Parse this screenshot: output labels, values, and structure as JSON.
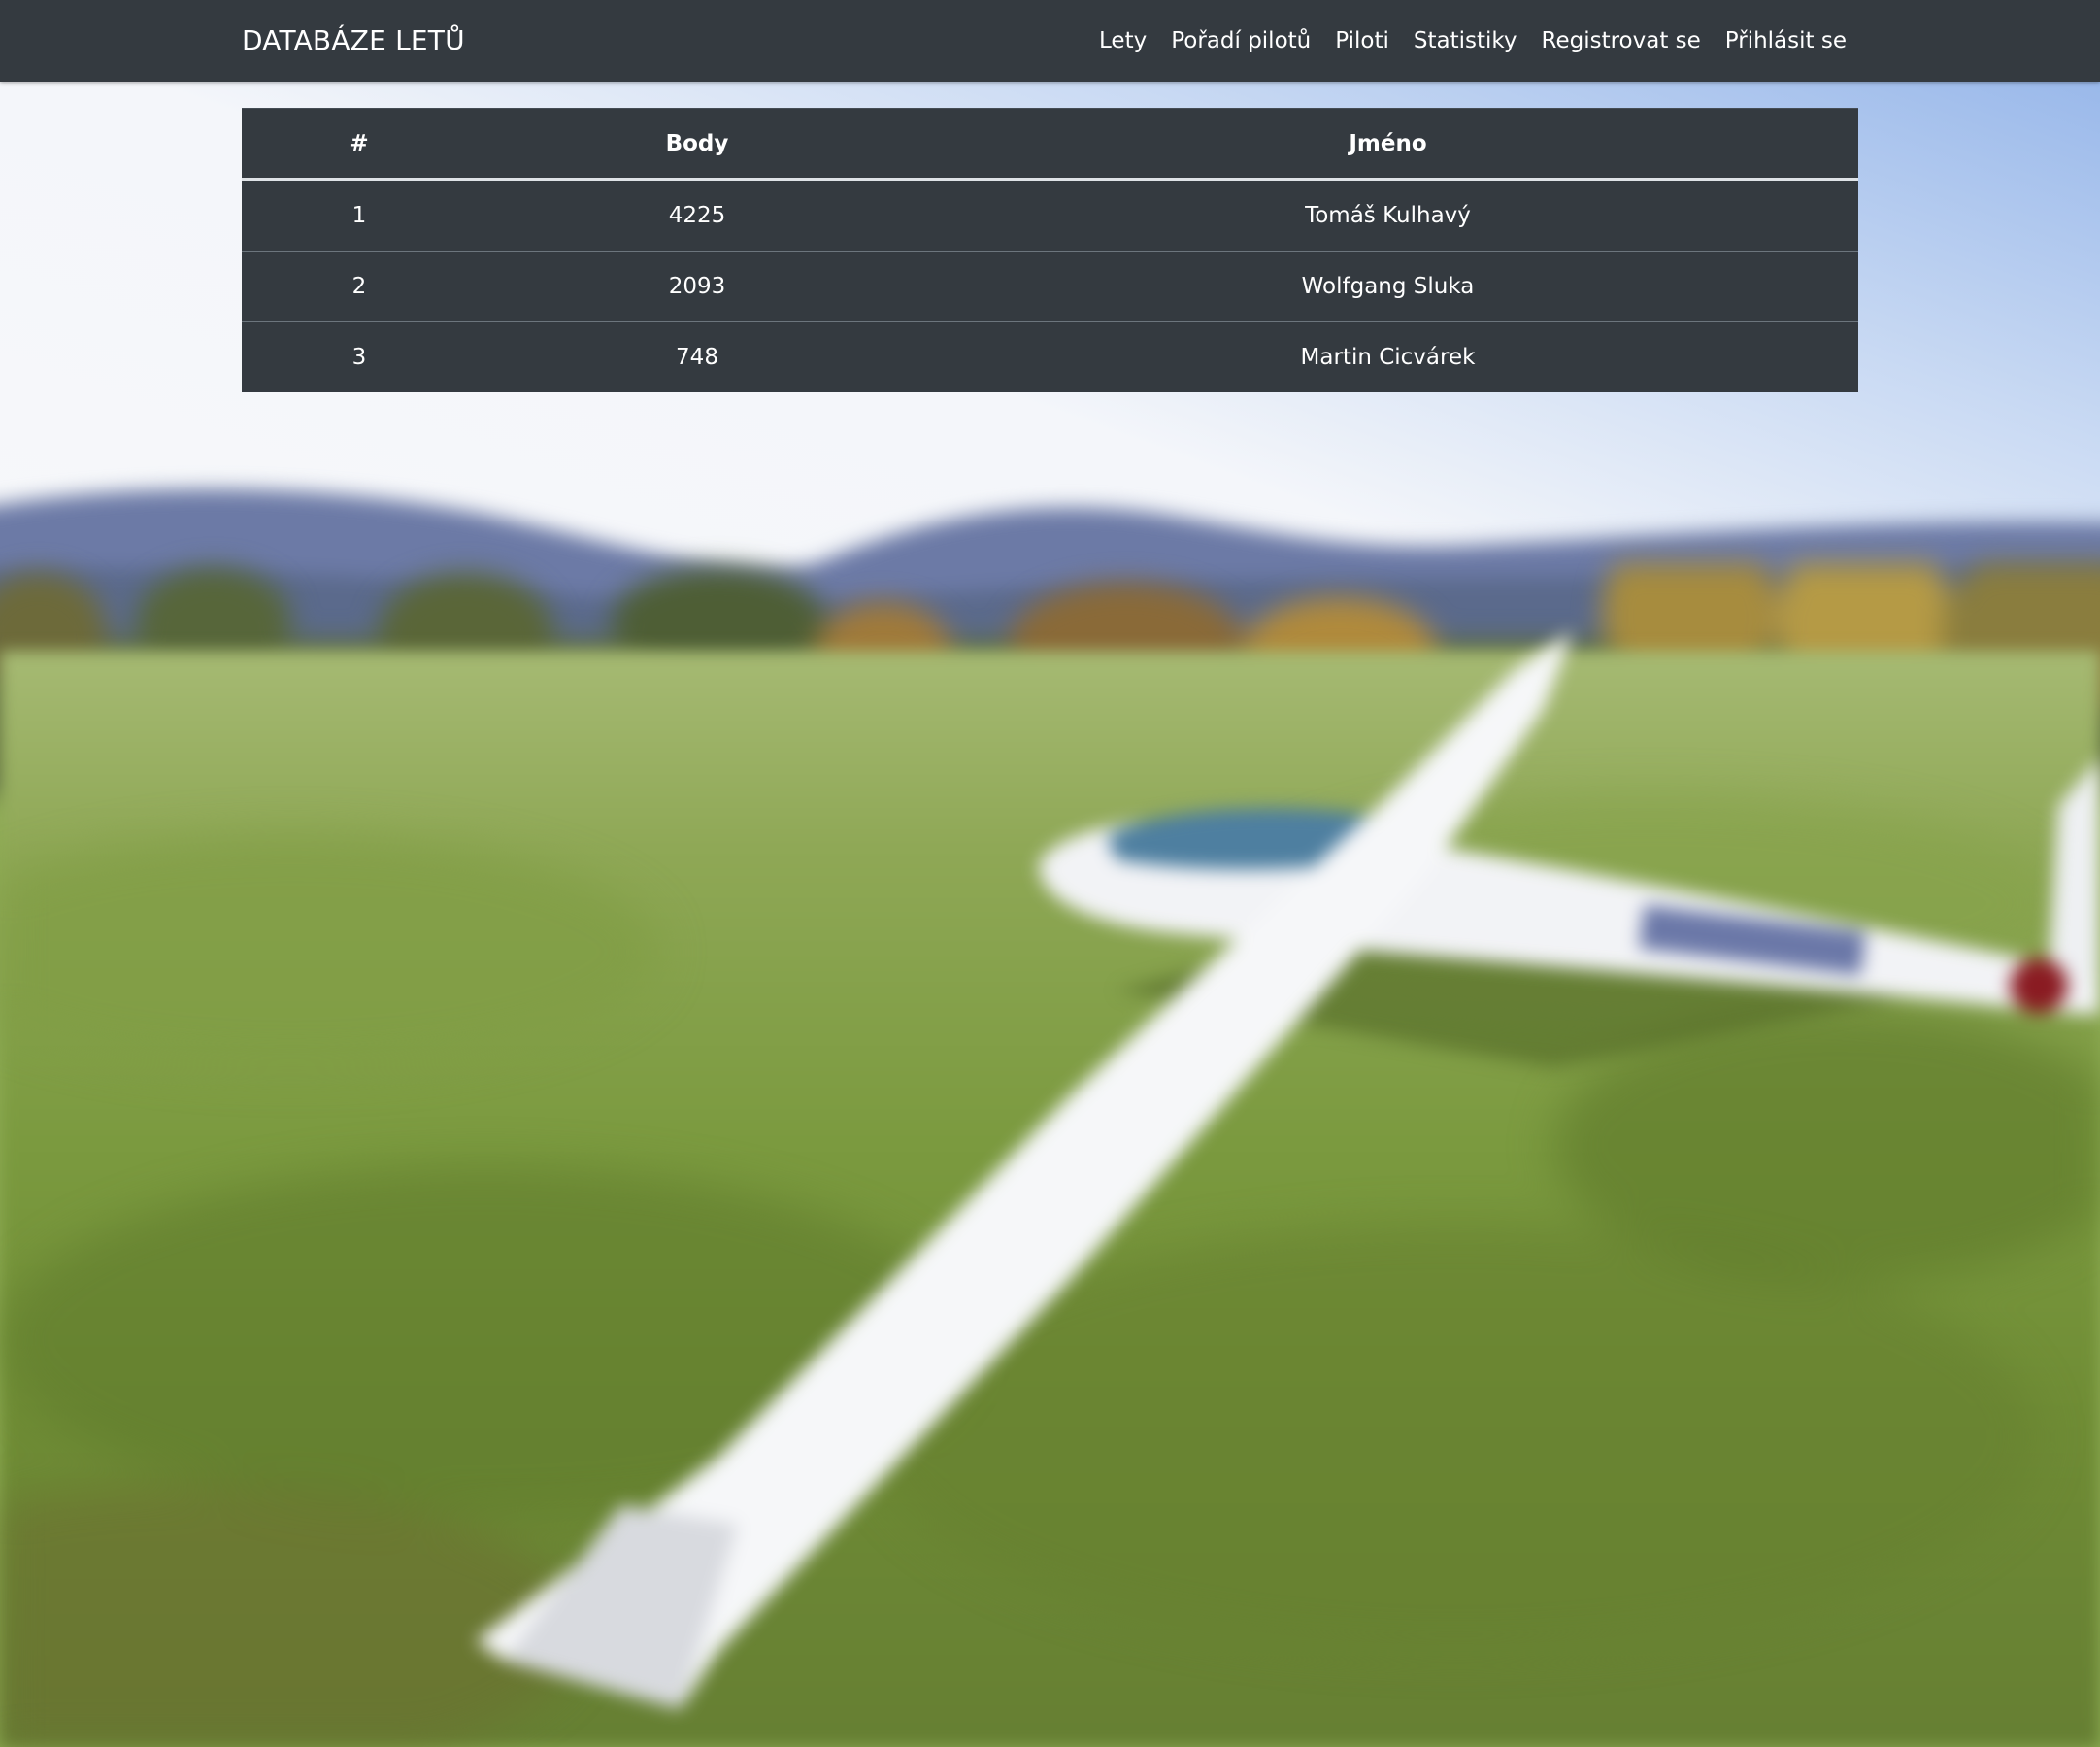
{
  "navbar": {
    "brand": "DATABÁZE LETŮ",
    "links": [
      {
        "label": "Lety"
      },
      {
        "label": "Pořadí pilotů"
      },
      {
        "label": "Piloti"
      },
      {
        "label": "Statistiky"
      },
      {
        "label": "Registrovat se"
      },
      {
        "label": "Přihlásit se"
      }
    ]
  },
  "ranking_table": {
    "headers": [
      "#",
      "Body",
      "Jméno"
    ],
    "rows": [
      {
        "rank": "1",
        "points": "4225",
        "name": "Tomáš Kulhavý"
      },
      {
        "rank": "2",
        "points": "2093",
        "name": "Wolfgang Sluka"
      },
      {
        "rank": "3",
        "points": "748",
        "name": "Martin Cicvárek"
      }
    ]
  },
  "colors": {
    "navbar_bg": "#343a40",
    "table_bg": "#343a40",
    "text": "#ffffff"
  }
}
